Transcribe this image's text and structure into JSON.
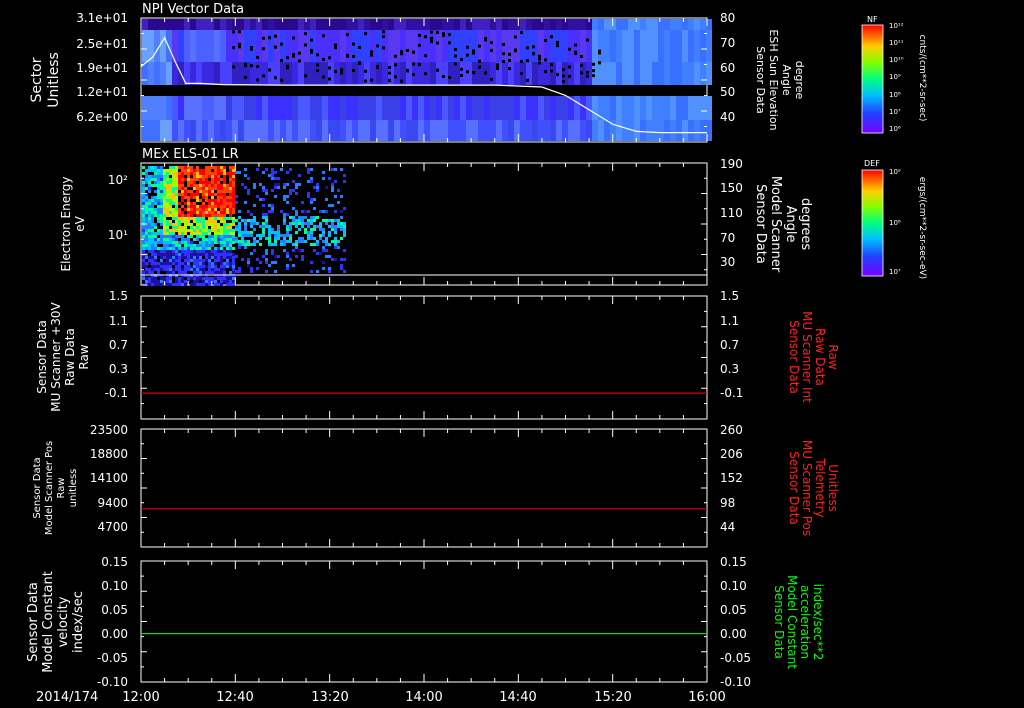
{
  "time_axis": {
    "date": "2014/174",
    "ticks": [
      "12:00",
      "12:40",
      "13:20",
      "14:00",
      "14:40",
      "15:20",
      "16:00"
    ]
  },
  "colorbars": [
    {
      "label": "NF",
      "units": "cnts/(cm**2-sr-sec)",
      "tick_labels": [
        "10¹²",
        "10¹¹",
        "10¹⁰",
        "10⁹",
        "10⁸",
        "10⁷",
        "10⁶"
      ]
    },
    {
      "label": "DEF",
      "units": "ergs/(cm**2-sr-sec-eV)",
      "tick_labels": [
        "10⁹",
        "10⁸",
        "10⁷"
      ]
    }
  ],
  "colors": {
    "axis": "#ffffff",
    "panel3_line": "#dd0000",
    "panel4_line": "#dd0000",
    "panel5_line": "#00dd00",
    "right_label_red": "#ff2020",
    "right_label_green": "#00ff00"
  },
  "chart_data": [
    {
      "type": "heatmap",
      "title": "NPI Vector Data",
      "ylabel": [
        "Sector",
        "Unitless"
      ],
      "ytick_labels": [
        "3.1e+01",
        "2.5e+01",
        "1.9e+01",
        "1.2e+01",
        "6.2e+00"
      ],
      "ylabel_right": [
        "Sensor Data",
        "ESH Sun Elevation",
        "Angle",
        "degree"
      ],
      "ytick_labels_right": [
        "80",
        "70",
        "60",
        "50",
        "40"
      ],
      "ylim_right": [
        30,
        80
      ],
      "overlay_line": {
        "x": [
          "12:00",
          "12:05",
          "12:10",
          "12:15",
          "12:19",
          "12:25",
          "12:35",
          "13:00",
          "13:30",
          "14:00",
          "14:30",
          "14:50",
          "15:00",
          "15:10",
          "15:20",
          "15:30",
          "15:40",
          "16:00"
        ],
        "y": [
          61,
          65,
          73,
          62,
          54,
          54,
          53.5,
          53.3,
          53.3,
          53.3,
          53.3,
          52.5,
          49,
          43,
          37,
          34,
          33.5,
          33.5
        ]
      }
    },
    {
      "type": "heatmap",
      "title": "MEx ELS-01 LR",
      "ylabel": [
        "Electron Energy",
        "eV"
      ],
      "ytick_labels": [
        "10²",
        "10¹"
      ],
      "ylabel_right": [
        "Sensor Data",
        "Model Scanner",
        "Angle",
        "degrees"
      ],
      "ytick_labels_right": [
        "190",
        "150",
        "110",
        "70",
        "30"
      ],
      "ylim_right": [
        0,
        190
      ],
      "overlay_line": {
        "x": [
          "12:00",
          "16:00"
        ],
        "y": [
          10,
          10
        ]
      }
    },
    {
      "type": "line",
      "ylabel": [
        "Sensor Data",
        "MU Scanner +30V",
        "Raw Data",
        "Raw"
      ],
      "ytick_labels": [
        "1.5",
        "1.1",
        "0.7",
        "0.3",
        "-0.1"
      ],
      "ylim": [
        -0.4,
        1.5
      ],
      "ylabel_right": [
        "Sensor Data",
        "MU Scanner Int",
        "Raw Data",
        "Raw"
      ],
      "ytick_labels_right": [
        "1.5",
        "1.1",
        "0.7",
        "0.3",
        "-0.1"
      ],
      "series": [
        {
          "x": [
            "12:00",
            "16:00"
          ],
          "values": [
            0.0,
            0.0
          ]
        }
      ]
    },
    {
      "type": "line",
      "ylabel": [
        "Sensor Data",
        "Model Scanner Pos",
        "Raw",
        "unitless"
      ],
      "ytick_labels": [
        "23500",
        "18800",
        "14100",
        "9400",
        "4700"
      ],
      "ylim": [
        0,
        23500
      ],
      "ylabel_right": [
        "Sensor Data",
        "MU Scanner Pos",
        "Telemetry",
        "Unitless"
      ],
      "ytick_labels_right": [
        "260",
        "206",
        "152",
        "98",
        "44"
      ],
      "series": [
        {
          "x": [
            "12:00",
            "16:00"
          ],
          "values": [
            7600,
            7600
          ]
        }
      ]
    },
    {
      "type": "line",
      "ylabel": [
        "Sensor Data",
        "Model Constant",
        "velocity",
        "index/sec"
      ],
      "ytick_labels": [
        "0.15",
        "0.10",
        "0.05",
        "0.00",
        "-0.05",
        "-0.10"
      ],
      "ylim": [
        -0.1,
        0.15
      ],
      "ylabel_right": [
        "Sensor Data",
        "Model Constant",
        "acceleration",
        "index/sec**2"
      ],
      "ytick_labels_right": [
        "0.15",
        "0.10",
        "0.05",
        "0.00",
        "-0.05",
        "-0.10"
      ],
      "series": [
        {
          "x": [
            "12:00",
            "16:00"
          ],
          "values": [
            0.0,
            0.0
          ]
        }
      ]
    }
  ]
}
